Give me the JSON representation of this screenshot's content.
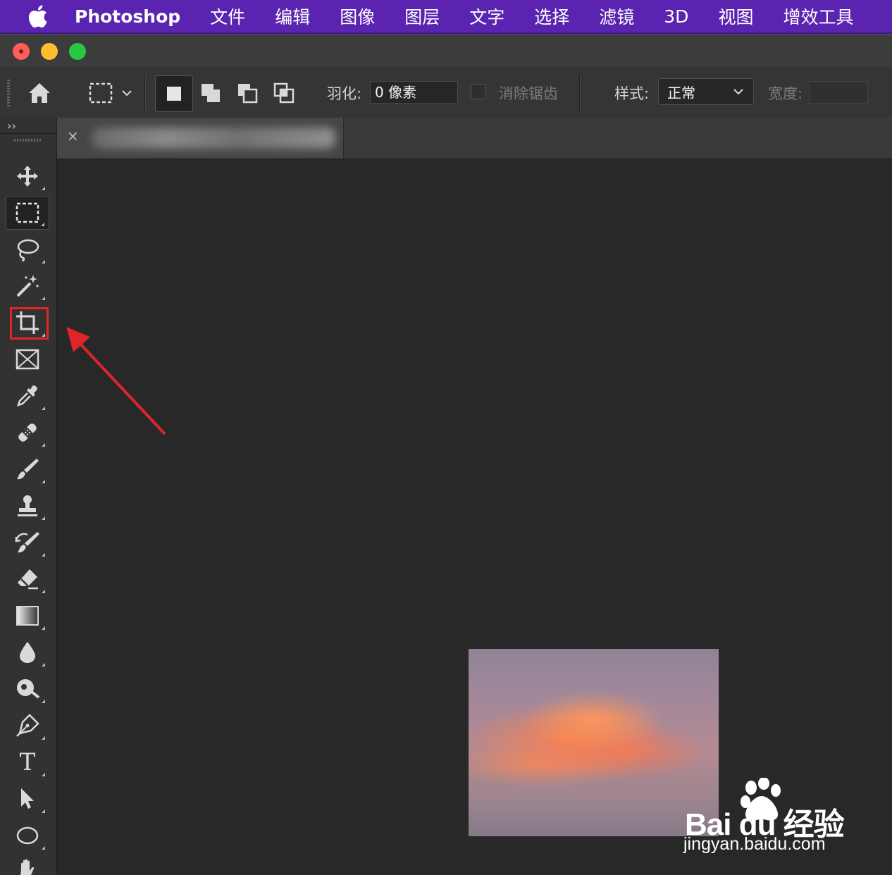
{
  "menubar": {
    "app_name": "Photoshop",
    "items": [
      "文件",
      "编辑",
      "图像",
      "图层",
      "文字",
      "选择",
      "滤镜",
      "3D",
      "视图",
      "增效工具"
    ]
  },
  "options_bar": {
    "feather_label": "羽化:",
    "feather_value": "0 像素",
    "antialias_label": "消除锯齿",
    "style_label": "样式:",
    "style_value": "正常",
    "width_label": "宽度:",
    "width_value": ""
  },
  "toolbar": {
    "collapse_label": "››",
    "tools": [
      "move",
      "rectangular-marquee",
      "lasso",
      "magic-wand",
      "crop",
      "frame",
      "eyedropper",
      "spot-healing",
      "brush",
      "clone-stamp",
      "history-brush",
      "eraser",
      "gradient",
      "blur",
      "dodge",
      "pen",
      "type",
      "path-selection",
      "ellipse",
      "hand"
    ],
    "active_tool": "rectangular-marquee",
    "highlighted_tool": "crop",
    "type_tool_glyph": "T"
  },
  "document_tab": {
    "close_glyph": "×"
  },
  "watermark": {
    "brand": "Bai du 经验",
    "url": "jingyan.baidu.com"
  },
  "colors": {
    "menubar": "#5a24b0",
    "highlight": "#e0242a",
    "arrow": "#e0242a",
    "canvas": "#282828"
  }
}
